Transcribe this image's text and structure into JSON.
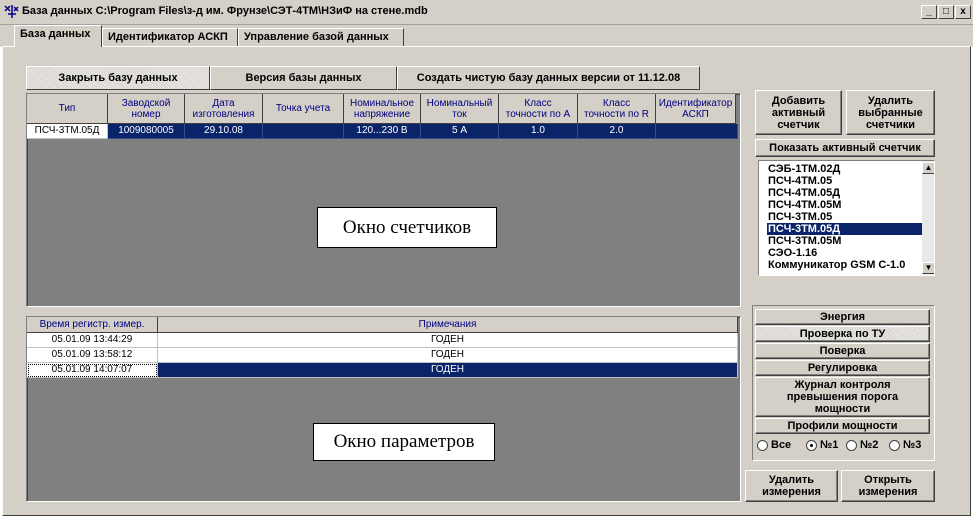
{
  "window": {
    "title": "База данных C:\\Program Files\\з-д им. Фрунзе\\СЭТ-4ТМ\\НЗиФ на стене.mdb",
    "minimize": "_",
    "maximize": "□",
    "close": "x"
  },
  "outer_tabs": [
    "База данных",
    "Идентификатор АСКП",
    "Управление базой данных"
  ],
  "inner_tabs": [
    "Закрыть базу данных",
    "Версия базы данных",
    "Создать чистую базу данных версии от 11.12.08"
  ],
  "meters_grid": {
    "columns": [
      "Тип",
      "Заводской\nномер",
      "Дата\nизготовления",
      "Точка учета",
      "Номинальное\nнапряжение",
      "Номинальный\nток",
      "Класс\nточности по А",
      "Класс\nточности по R",
      "Идентификатор\nАСКП"
    ],
    "rows": [
      [
        "ПСЧ-3ТМ.05Д",
        "1009080005",
        "29.10.08",
        "",
        "120...230 В",
        "5 А",
        "1.0",
        "2.0",
        ""
      ]
    ],
    "overlay_label": "Окно счетчиков"
  },
  "params_grid": {
    "columns": [
      "Время регистр. измер.",
      "Примечания"
    ],
    "rows": [
      [
        "05.01.09 13:44:29",
        "ГОДЕН"
      ],
      [
        "05.01.09 13:58:12",
        "ГОДЕН"
      ],
      [
        "05.01.09 14:07:07",
        "ГОДЕН"
      ]
    ],
    "selected_row": 2,
    "overlay_label": "Окно параметров"
  },
  "right_panel": {
    "add_active": "Добавить\nактивный\nсчетчик",
    "delete_selected": "Удалить\nвыбранные\nсчетчики",
    "show_active": "Показать активный счетчик",
    "meter_types": [
      "СЭБ-1ТМ.02Д",
      "ПСЧ-4ТМ.05",
      "ПСЧ-4ТМ.05Д",
      "ПСЧ-4ТМ.05М",
      "ПСЧ-3ТМ.05",
      "ПСЧ-3ТМ.05Д",
      "ПСЧ-3ТМ.05М",
      "СЭО-1.16",
      "Коммуникатор GSM С-1.0"
    ],
    "selected_meter_index": 5,
    "measurement_buttons": [
      "Энергия",
      "Проверка по ТУ",
      "Поверка",
      "Регулировка",
      "Журнал контроля\nпревышения порога\nмощности",
      "Профили мощности"
    ],
    "radio_options": [
      "Все",
      "№1",
      "№2",
      "№3"
    ],
    "radio_selected": "№1",
    "delete_measurements": "Удалить\nизмерения",
    "open_measurements": "Открыть\nизмерения"
  },
  "colors": {
    "selection": "#0a246a",
    "header_text": "#000080",
    "grid_background": "#808080",
    "face": "#d4d0c8"
  }
}
